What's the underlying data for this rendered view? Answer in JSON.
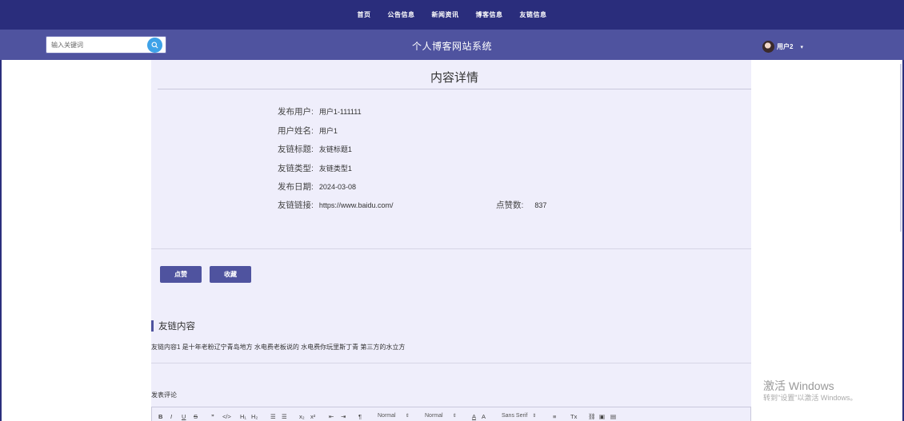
{
  "nav": {
    "items": [
      "首页",
      "公告信息",
      "新闻资讯",
      "博客信息",
      "友链信息"
    ]
  },
  "header": {
    "search_placeholder": "输入关键词",
    "site_title": "个人博客网站系统",
    "username": "用户2"
  },
  "detail": {
    "title": "内容详情",
    "fields": [
      {
        "label": "发布用户:",
        "value": "用户1-111111"
      },
      {
        "label": "用户姓名:",
        "value": "用户1"
      },
      {
        "label": "友链标题:",
        "value": "友链标题1"
      },
      {
        "label": "友链类型:",
        "value": "友链类型1"
      },
      {
        "label": "发布日期:",
        "value": "2024-03-08"
      },
      {
        "label": "友链链接:",
        "value": "https://www.baidu.com/"
      }
    ],
    "likes": {
      "label": "点赞数:",
      "value": "837"
    }
  },
  "actions": {
    "like": "点赞",
    "favorite": "收藏"
  },
  "section": {
    "title": "友链内容",
    "text": "友链内容1 是十年老粉辽宁青岛地方 水电费老板说的 水电费你玩里斯丁青 第三方的水立方"
  },
  "comment": {
    "label": "发表评论"
  },
  "editor": {
    "header1": "Normal",
    "header2": "Normal",
    "font": "Sans Serif"
  },
  "watermark": {
    "line1": "激活 Windows",
    "line2": "转到\"设置\"以激活 Windows。"
  }
}
